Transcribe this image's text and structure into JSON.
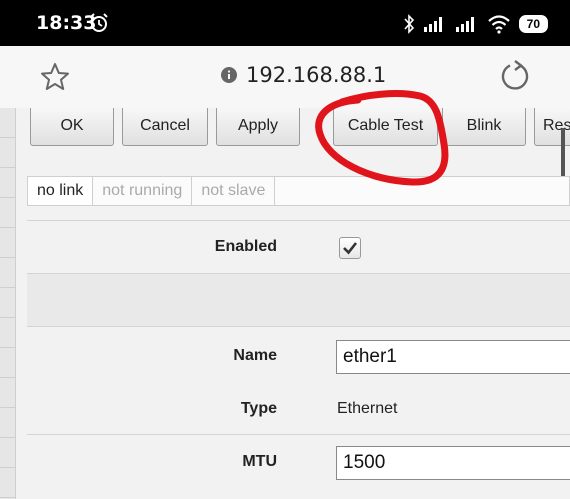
{
  "status_bar": {
    "time": "18:33",
    "battery": "70"
  },
  "browser": {
    "url": "192.168.88.1"
  },
  "toolbar": {
    "buttons": [
      "OK",
      "Cancel",
      "Apply",
      "Cable Test",
      "Blink",
      "Res"
    ]
  },
  "interface_flags": [
    {
      "label": "no link",
      "active": true
    },
    {
      "label": "not running",
      "active": false
    },
    {
      "label": "not slave",
      "active": false
    }
  ],
  "form": {
    "enabled_label": "Enabled",
    "enabled_checked": true,
    "name_label": "Name",
    "name_value": "ether1",
    "type_label": "Type",
    "type_value": "Ethernet",
    "mtu_label": "MTU",
    "mtu_value": "1500"
  },
  "colors": {
    "annotation": "#e0141b",
    "status_bar_bg": "#000000",
    "page_bg": "#f2f2f2"
  }
}
